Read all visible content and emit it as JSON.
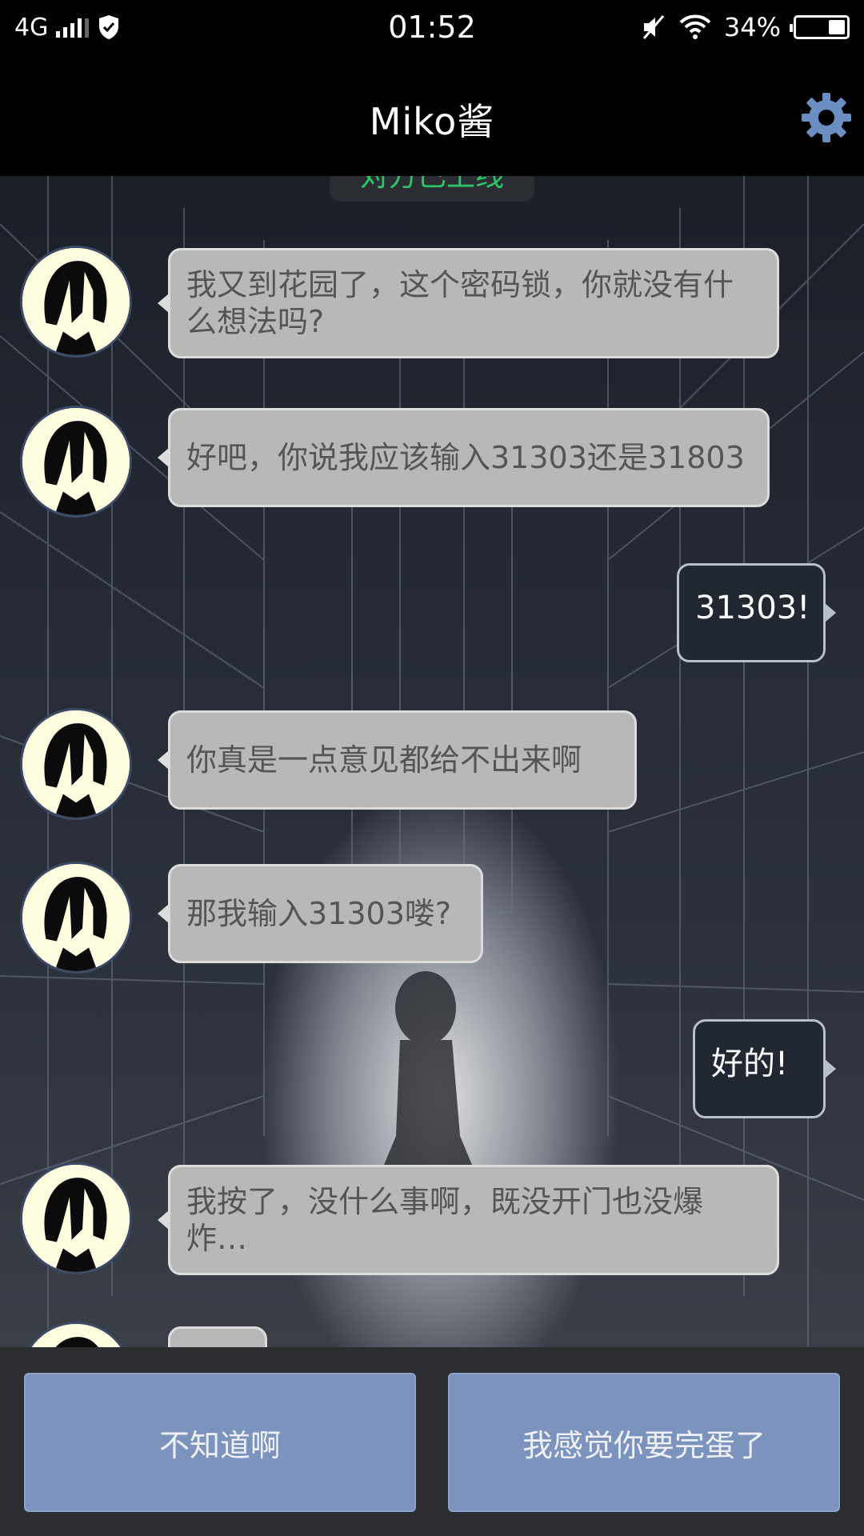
{
  "status_bar": {
    "network": "4G",
    "time": "01:52",
    "battery_percent": "34%",
    "battery_level": 0.34
  },
  "header": {
    "title": "Miko酱",
    "settings_icon": "gear-icon"
  },
  "chat": {
    "system_notice": "对方已上线",
    "messages": [
      {
        "sender": "Miko",
        "text": "我又到花园了，这个密码锁，你就没有什么想法吗?"
      },
      {
        "sender": "Miko",
        "text": "好吧，你说我应该输入31303还是31803"
      },
      {
        "sender": "me",
        "text": "31303!"
      },
      {
        "sender": "Miko",
        "text": "你真是一点意见都给不出来啊"
      },
      {
        "sender": "Miko",
        "text": "那我输入31303喽?"
      },
      {
        "sender": "me",
        "text": "好的!"
      },
      {
        "sender": "Miko",
        "text": "我按了，没什么事啊，既没开门也没爆炸…"
      },
      {
        "sender": "Miko",
        "text": ""
      }
    ]
  },
  "choices": [
    {
      "label": "不知道啊"
    },
    {
      "label": "我感觉你要完蛋了"
    }
  ],
  "colors": {
    "accent": "#7b93bd",
    "online_notice": "#2ec46a",
    "incoming_bubble": "#b8b8b8",
    "outgoing_bubble": "#222831"
  }
}
